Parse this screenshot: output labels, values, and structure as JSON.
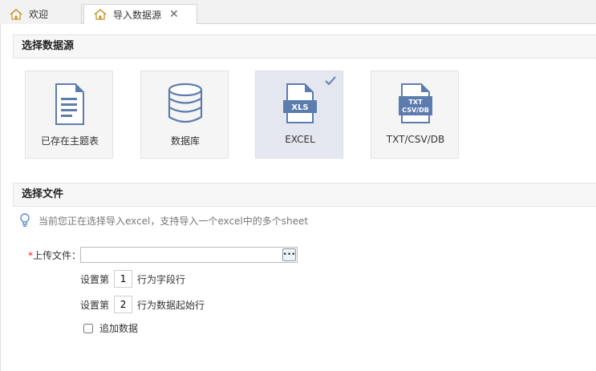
{
  "tabs": [
    {
      "label": "欢迎",
      "icon": "home-icon",
      "active": false
    },
    {
      "label": "导入数据源",
      "icon": "home-icon",
      "active": true,
      "close": "✕"
    }
  ],
  "sections": {
    "source_title": "选择数据源",
    "file_title": "选择文件"
  },
  "sources": [
    {
      "label": "已存在主题表",
      "icon": "document-icon",
      "selected": false
    },
    {
      "label": "数据库",
      "icon": "database-icon",
      "selected": false
    },
    {
      "label": "EXCEL",
      "icon": "xls-file-icon",
      "icon_text": "XLS",
      "selected": true
    },
    {
      "label": "TXT/CSV/DB",
      "icon": "txt-csv-db-file-icon",
      "icon_text_1": "TXT",
      "icon_text_2": "CSV/DB",
      "selected": false
    }
  ],
  "hint": "当前您正在选择导入excel，支持导入一个excel中的多个sheet",
  "form": {
    "required_mark": "*",
    "upload_label": "上传文件：",
    "upload_value": "",
    "browse_glyph": "•••",
    "header_row": {
      "prefix": "设置第",
      "value": "1",
      "suffix": "行为字段行"
    },
    "data_row": {
      "prefix": "设置第",
      "value": "2",
      "suffix": "行为数据起始行"
    },
    "append_label": "追加数据",
    "append_checked": false
  },
  "colors": {
    "icon_blue": "#5d7cae",
    "selected_bg": "#e4e6f0",
    "required_red": "#e02233"
  }
}
